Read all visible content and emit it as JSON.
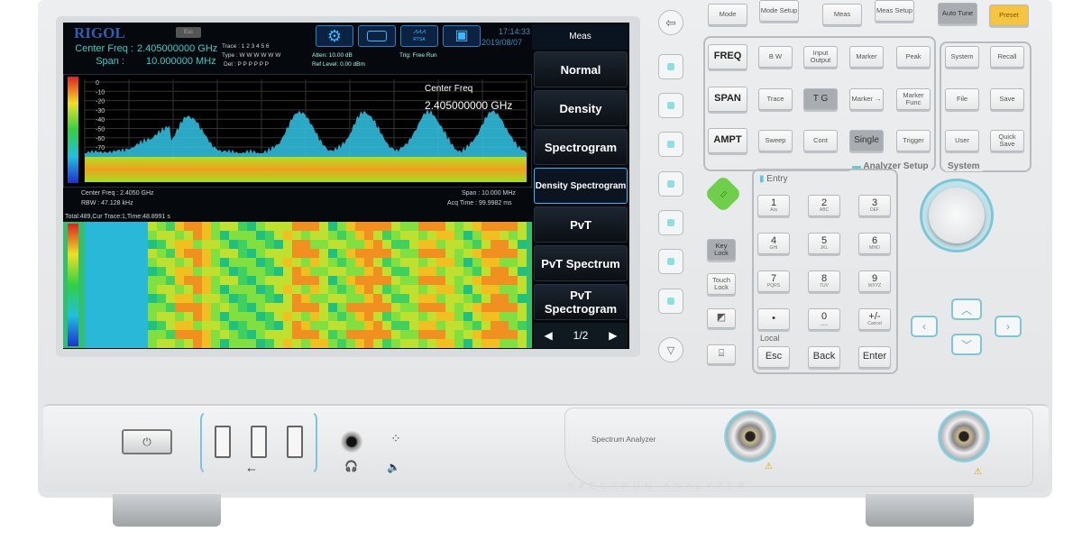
{
  "screen": {
    "brand": "RIGOL",
    "esc": "Esc",
    "center_freq_label": "Center Freq :",
    "center_freq": "2.405000000 GHz",
    "span_label": "Span :",
    "span": "10.000000 MHz",
    "trace_row": "Trace : 1 2 3 4 5 6",
    "type_row": "Type : W W W W W W",
    "det_row": "Det : P P P P P P",
    "atten": "Atten: 10.00 dB",
    "ref_level": "Ref Level: 0.00 dBm",
    "trig": "Trig: Free Run",
    "toolbar_icons": [
      "gear-icon",
      "density-icon",
      "rtsa-icon",
      "layout-icon"
    ],
    "rtsa_label": "RTSA",
    "time": "17:14:33",
    "date": "2019/08/07",
    "y_ticks": [
      "0",
      "-10",
      "-20",
      "-30",
      "-40",
      "-50",
      "-60",
      "-70"
    ],
    "marker_title": "Center Freq",
    "marker_value": "2.405000000 GHz",
    "footer_center": "Center Freq : 2.4050 GHz",
    "footer_rbw": "RBW : 47.128 kHz",
    "footer_span": "Span : 10.000 MHz",
    "footer_acq": "Acq Time : 99.9982 ms",
    "spectrogram_status": "Total:489,Cur Trace:1,Time:48.8991 s",
    "menu": {
      "title": "Meas",
      "items": [
        "Normal",
        "Density",
        "Spectrogram",
        "Density Spectrogram",
        "PvT",
        "PvT Spectrum",
        "PvT Spectrogram"
      ],
      "selected": "Density Spectrogram",
      "page": "1/2"
    }
  },
  "top_keys": [
    "Mode",
    "Mode Setup",
    "Meas",
    "Meas Setup",
    "Auto Tune",
    "Preset"
  ],
  "analyzer_keys": [
    [
      "FREQ",
      "B W",
      "Input Output",
      "Marker",
      "Peak"
    ],
    [
      "SPAN",
      "Trace",
      "T G",
      "Marker →",
      "Marker Func"
    ],
    [
      "AMPT",
      "Sweep",
      "Cont",
      "Single",
      "Trigger"
    ]
  ],
  "analyzer_label": "Analyzer Setup",
  "system_keys": [
    [
      "System",
      "Recall"
    ],
    [
      "File",
      "Save"
    ],
    [
      "User",
      "Quick Save"
    ]
  ],
  "system_label": "System",
  "side_keys": [
    "Key Lock",
    "Touch Lock"
  ],
  "entry": {
    "label": "Entry",
    "keys": [
      [
        "1",
        "A/a"
      ],
      [
        "2",
        "ABC"
      ],
      [
        "3",
        "DEF"
      ],
      [
        "4",
        "GHI"
      ],
      [
        "5",
        "JKL"
      ],
      [
        "6",
        "MNO"
      ],
      [
        "7",
        "PQRS"
      ],
      [
        "8",
        "TUV"
      ],
      [
        "9",
        "WXYZ"
      ],
      [
        "•",
        ""
      ],
      [
        "0",
        "___"
      ],
      [
        "+/-",
        "Cancel"
      ]
    ],
    "local_label": "Local",
    "bottom": [
      "Esc",
      "Back",
      "Enter"
    ]
  },
  "front": {
    "model_label": "Spectrum Analyzer",
    "watermark": "SPECTRUM ANALYZER"
  },
  "colors": {
    "preset": "#f5c542",
    "screen_accent": "#37b6ff",
    "text_cyan": "#36d0c8",
    "trace": "#33c6e6"
  }
}
